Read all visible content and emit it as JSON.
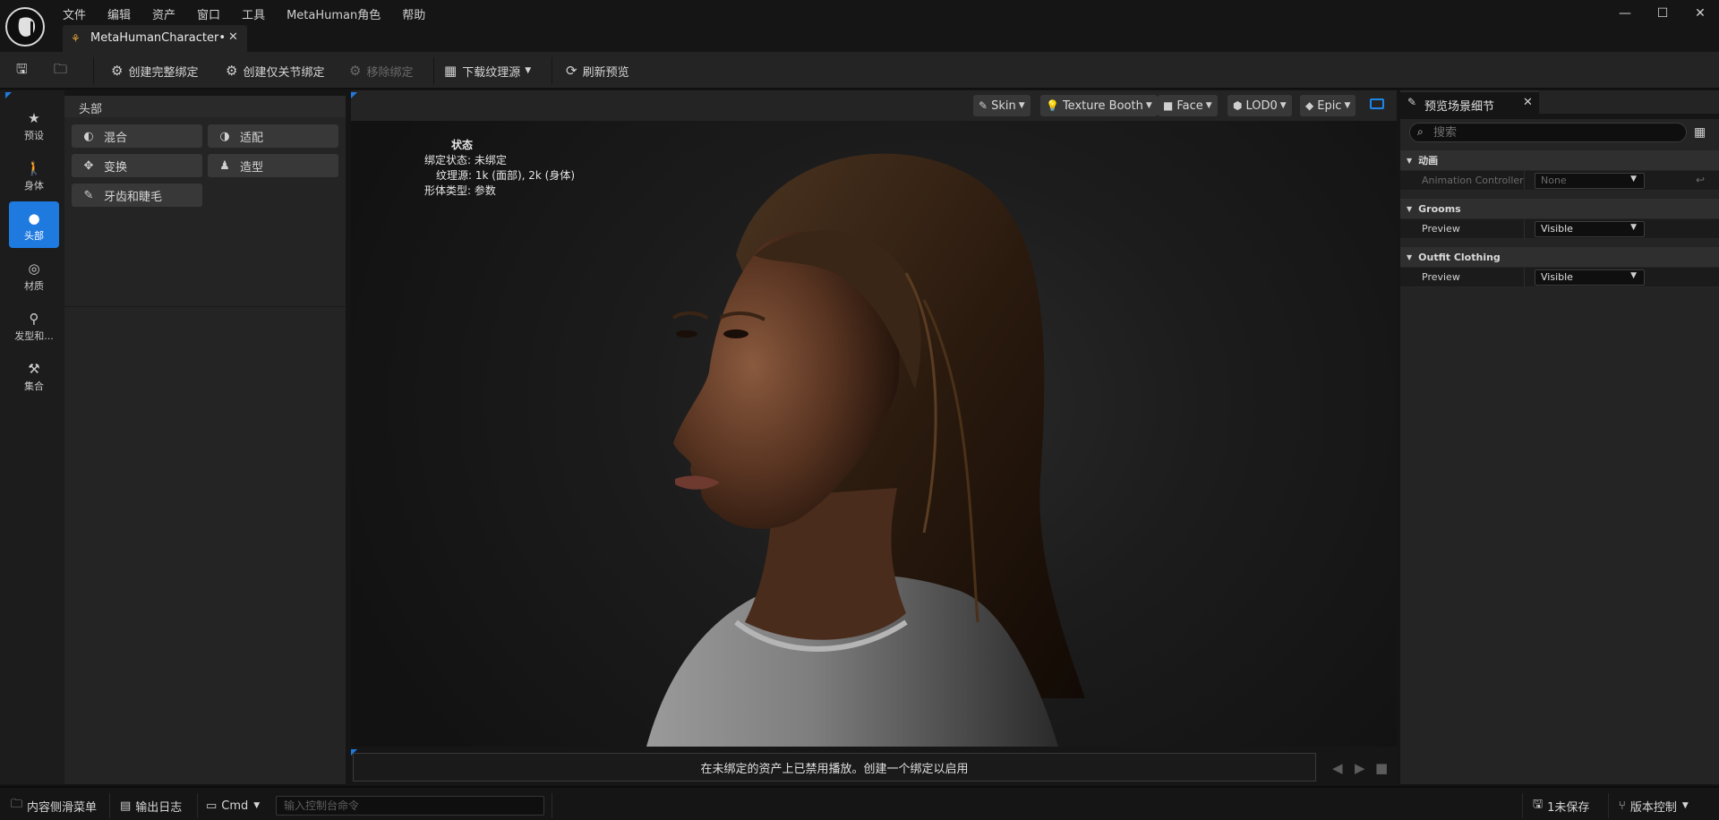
{
  "menu": [
    "文件",
    "编辑",
    "资产",
    "窗口",
    "工具",
    "MetaHuman角色",
    "帮助"
  ],
  "window_controls": {
    "minimize": "—",
    "maximize": "☐",
    "close": "✕"
  },
  "document_tab": {
    "label": "MetaHumanCharacter•",
    "close": "✕"
  },
  "toolbar": {
    "create_full_rig": "创建完整绑定",
    "create_joint_rig": "创建仅关节绑定",
    "remove_rig": "移除绑定",
    "download_textures": "下载纹理源",
    "refresh_preview": "刷新预览"
  },
  "left_nav": [
    {
      "label": "预设",
      "icon": "star-icon"
    },
    {
      "label": "身体",
      "icon": "body-icon"
    },
    {
      "label": "头部",
      "icon": "head-icon",
      "active": true
    },
    {
      "label": "材质",
      "icon": "material-icon"
    },
    {
      "label": "发型和...",
      "icon": "hair-icon"
    },
    {
      "label": "集合",
      "icon": "hammer-icon"
    }
  ],
  "head_panel": {
    "title": "头部",
    "tools": [
      {
        "label": "混合",
        "icon": "blend-icon"
      },
      {
        "label": "适配",
        "icon": "conform-icon"
      },
      {
        "label": "变换",
        "icon": "transform-icon"
      },
      {
        "label": "造型",
        "icon": "sculpt-icon"
      },
      {
        "label": "牙齿和睫毛",
        "icon": "brush-icon"
      }
    ]
  },
  "viewport": {
    "chips": [
      {
        "label": "Skin",
        "icon": "brush-icon"
      },
      {
        "label": "Texture Booth",
        "icon": "lightbulb-icon"
      },
      {
        "label": "Face",
        "icon": "camera-icon"
      },
      {
        "label": "LOD0",
        "icon": "cube-icon"
      },
      {
        "label": "Epic",
        "icon": "diamond-icon"
      }
    ],
    "status": {
      "title": "状态",
      "rig_state": "绑定状态: 未绑定",
      "texture_source": "纹理源: 1k (面部), 2k (身体)",
      "body_type": "形体类型: 参数"
    }
  },
  "playback": {
    "message": "在未绑定的资产上已禁用播放。创建一个绑定以启用"
  },
  "details": {
    "tab_label": "预览场景细节",
    "tab_close": "✕",
    "search_placeholder": "搜索",
    "sections": [
      {
        "title": "动画",
        "rows": [
          {
            "name": "Animation Controller",
            "value": "None",
            "disabled": true
          }
        ]
      },
      {
        "title": "Grooms",
        "rows": [
          {
            "name": "Preview",
            "value": "Visible"
          }
        ]
      },
      {
        "title": "Outfit Clothing",
        "rows": [
          {
            "name": "Preview",
            "value": "Visible"
          }
        ]
      }
    ]
  },
  "statusbar": {
    "content_drawer": "内容侧滑菜单",
    "output_log": "输出日志",
    "cmd": "Cmd",
    "console_placeholder": "输入控制台命令",
    "unsaved": "1未保存",
    "source_control": "版本控制"
  },
  "colors": {
    "accent": "#1f7ae0",
    "panel": "#242424",
    "background": "#151515",
    "tab_icon": "#e0a43a"
  }
}
